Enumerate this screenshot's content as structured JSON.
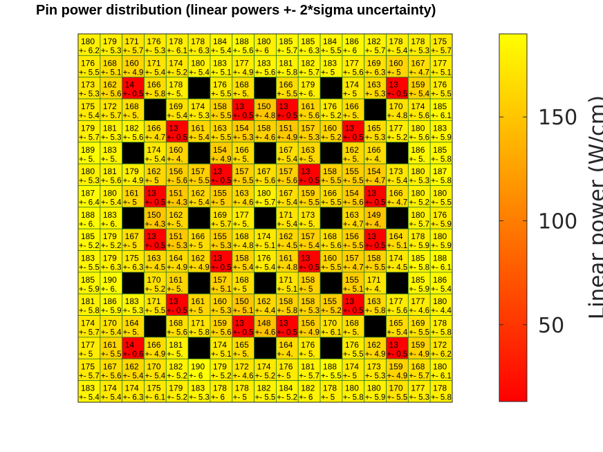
{
  "chart_data": {
    "type": "heatmap",
    "title": "Pin power distribution (linear powers +- 2*sigma uncertainty)",
    "colorbar": {
      "label": "Linear power (W/cm)",
      "ticks": [
        50,
        100,
        150
      ],
      "tick_labels": [
        "50",
        "100",
        "150"
      ],
      "range": [
        13,
        190
      ],
      "colormap": [
        "#ff0000",
        "#ffff00"
      ]
    },
    "values": [
      [
        180,
        179,
        171,
        176,
        178,
        178,
        184,
        188,
        180,
        185,
        185,
        184,
        186,
        182,
        178,
        178,
        175
      ],
      [
        176,
        168,
        160,
        171,
        174,
        180,
        183,
        177,
        183,
        181,
        182,
        183,
        177,
        169,
        160,
        167,
        177
      ],
      [
        173,
        162,
        14,
        166,
        178,
        null,
        176,
        168,
        null,
        166,
        179,
        null,
        174,
        163,
        13,
        159,
        176
      ],
      [
        175,
        172,
        168,
        null,
        169,
        174,
        158,
        13,
        150,
        13,
        161,
        176,
        166,
        null,
        170,
        174,
        185
      ],
      [
        179,
        181,
        182,
        166,
        13,
        161,
        163,
        154,
        158,
        151,
        157,
        160,
        13,
        165,
        177,
        180,
        183
      ],
      [
        189,
        183,
        null,
        174,
        160,
        null,
        154,
        166,
        null,
        167,
        163,
        null,
        162,
        166,
        null,
        186,
        185
      ],
      [
        180,
        181,
        179,
        162,
        156,
        157,
        13,
        157,
        167,
        157,
        13,
        158,
        155,
        154,
        173,
        180,
        187
      ],
      [
        187,
        180,
        161,
        13,
        151,
        162,
        155,
        163,
        180,
        167,
        159,
        166,
        154,
        13,
        166,
        180,
        180
      ],
      [
        188,
        183,
        null,
        150,
        162,
        null,
        169,
        177,
        null,
        171,
        173,
        null,
        163,
        149,
        null,
        180,
        176
      ],
      [
        185,
        179,
        167,
        13,
        151,
        166,
        155,
        168,
        174,
        162,
        157,
        168,
        156,
        13,
        164,
        178,
        180
      ],
      [
        183,
        179,
        175,
        163,
        164,
        162,
        13,
        158,
        176,
        161,
        13,
        160,
        157,
        158,
        174,
        185,
        188
      ],
      [
        185,
        190,
        null,
        170,
        161,
        null,
        157,
        168,
        null,
        171,
        158,
        null,
        155,
        171,
        null,
        185,
        186
      ],
      [
        181,
        186,
        183,
        171,
        13,
        161,
        160,
        150,
        162,
        158,
        158,
        155,
        13,
        163,
        177,
        177,
        180
      ],
      [
        174,
        170,
        164,
        null,
        168,
        171,
        159,
        13,
        148,
        13,
        156,
        170,
        168,
        null,
        165,
        169,
        178
      ],
      [
        177,
        161,
        14,
        166,
        181,
        null,
        174,
        165,
        null,
        164,
        176,
        null,
        176,
        162,
        13,
        159,
        172
      ],
      [
        175,
        167,
        162,
        170,
        182,
        190,
        179,
        172,
        174,
        176,
        181,
        188,
        174,
        173,
        159,
        168,
        180
      ],
      [
        183,
        174,
        174,
        175,
        179,
        183,
        178,
        178,
        182,
        184,
        182,
        178,
        180,
        180,
        170,
        177,
        178
      ]
    ],
    "uncertainty_labels": [
      [
        "+- 6.2",
        "+- 5.3",
        "+- 5.7",
        "+- 5.3",
        "+- 6.1",
        "+- 6.3",
        "+- 5.4",
        "+- 5.6",
        "+- 6",
        "+- 5.7",
        "+- 6.3",
        "+- 5.5",
        "+- 6",
        "+- 5.7",
        "+- 5.4",
        "+- 5.3",
        "+- 5.7"
      ],
      [
        "+- 5.5",
        "+- 5.1",
        "+- 4.9",
        "+- 5.4",
        "+- 5.2",
        "+- 5.4",
        "+- 5.1",
        "+- 4.9",
        "+- 5.6",
        "+- 5.8",
        "+- 5.7",
        "+- 5",
        "+- 5.6",
        "+- 6.3",
        "+- 5",
        "+- 4.7",
        "+- 5.1"
      ],
      [
        "+- 5.3",
        "+- 5.6",
        "+- 0.5",
        "+- 5.8",
        "+- 5.",
        "",
        "+- 5.5",
        "+- 5.",
        "",
        "+- 5.5",
        "+- 6.",
        "",
        "+- 5",
        "+- 5.3",
        "+- 0.5",
        "+- 5.4",
        "+- 5.5"
      ],
      [
        "+- 5.4",
        "+- 5.7",
        "+- 5.",
        "",
        "+- 5.4",
        "+- 5.3",
        "+- 5.5",
        "+- 0.5",
        "+- 4.8",
        "+- 0.5",
        "+- 5.6",
        "+- 5.2",
        "+- 5.",
        "",
        "+- 4.8",
        "+- 5.6",
        "+- 6.1"
      ],
      [
        "+- 5.7",
        "+- 5.3",
        "+- 5.6",
        "+- 4.7",
        "+- 0.5",
        "+- 5.4",
        "+- 5.5",
        "+- 5.3",
        "+- 4.6",
        "+- 4.9",
        "+- 5.3",
        "+- 5.2",
        "+- 0.5",
        "+- 5.3",
        "+- 5.2",
        "+- 5.6",
        "+- 5.9"
      ],
      [
        "+- 5.",
        "+- 5.",
        "",
        "+- 5.4",
        "+- 4.",
        "",
        "+- 4.9",
        "+- 5.",
        "",
        "+- 5.4",
        "+- 5.",
        "",
        "+- 5.",
        "+- 4.",
        "",
        "+- 5.",
        "+- 5.8"
      ],
      [
        "+- 5.3",
        "+- 5.6",
        "+- 4.9",
        "+- 5",
        "+- 5.6",
        "+- 5.5",
        "+- 0.5",
        "+- 5.5",
        "+- 5.6",
        "+- 5.6",
        "+- 0.5",
        "+- 5.5",
        "+- 5.5",
        "+- 4.7",
        "+- 5.4",
        "+- 5.3",
        "+- 5.8"
      ],
      [
        "+- 6.4",
        "+- 5.4",
        "+- 5",
        "+- 0.5",
        "+- 4.3",
        "+- 5.4",
        "+- 5",
        "+- 4.6",
        "+- 5.7",
        "+- 5.4",
        "+- 5.5",
        "+- 5.5",
        "+- 5.6",
        "+- 0.5",
        "+- 4.7",
        "+- 5.2",
        "+- 5.5"
      ],
      [
        "+- 6.",
        "+- 6.",
        "",
        "+- 4.3",
        "+- 5.",
        "",
        "+- 5.7",
        "+- 5.",
        "",
        "+- 5.4",
        "+- 5.",
        "",
        "+- 4.7",
        "+- 4.",
        "",
        "+- 5.7",
        "+- 5.9"
      ],
      [
        "+- 5.2",
        "+- 5.2",
        "+- 5",
        "+- 0.5",
        "+- 5.3",
        "+- 5",
        "+- 5.3",
        "+- 4.8",
        "+- 5.1",
        "+- 4.5",
        "+- 5.4",
        "+- 5.6",
        "+- 5.5",
        "+- 0.5",
        "+- 5.1",
        "+- 5.9",
        "+- 5.9"
      ],
      [
        "+- 5.5",
        "+- 6.3",
        "+- 6.3",
        "+- 4.5",
        "+- 4.9",
        "+- 4.9",
        "+- 0.5",
        "+- 5.4",
        "+- 5.4",
        "+- 4.8",
        "+- 0.5",
        "+- 5.5",
        "+- 4.7",
        "+- 5.5",
        "+- 4.5",
        "+- 5.8",
        "+- 6.1"
      ],
      [
        "+- 5.9",
        "+- 6.",
        "",
        "+- 5.2",
        "+- 5.",
        "",
        "+- 5.1",
        "+- 5",
        "",
        "+- 5.1",
        "+- 5",
        "",
        "+- 5.1",
        "+- 4.",
        "",
        "+- 5.9",
        "+- 5.4"
      ],
      [
        "+- 5.8",
        "+- 5.9",
        "+- 5.3",
        "+- 5.5",
        "+- 0.5",
        "+- 5",
        "+- 5.3",
        "+- 5.1",
        "+- 4.4",
        "+- 5.8",
        "+- 5.3",
        "+- 5.2",
        "+- 0.5",
        "+- 5.8",
        "+- 5.6",
        "+- 4.6",
        "+- 4.4"
      ],
      [
        "+- 5.7",
        "+- 5.4",
        "+- 5.",
        "",
        "+- 5.6",
        "+- 5.8",
        "+- 5.6",
        "+- 0.5",
        "+- 4.6",
        "+- 0.5",
        "+- 4.9",
        "+- 6.1",
        "+- 5.",
        "",
        "+- 5.4",
        "+- 5.5",
        "+- 5.8"
      ],
      [
        "+- 5",
        "+- 5.5",
        "+- 0.6",
        "+- 4.9",
        "+- 5.",
        "",
        "+- 5.1",
        "+- 5.",
        "",
        "+- 4.",
        "+- 5.",
        "",
        "+- 5.5",
        "+- 4.9",
        "+- 0.5",
        "+- 4.9",
        "+- 6.2"
      ],
      [
        "+- 5.7",
        "+- 5.6",
        "+- 5.4",
        "+- 5.4",
        "+- 5.2",
        "+- 6",
        "+- 5.2",
        "+- 4.6",
        "+- 5.2",
        "+- 5",
        "+- 5.7",
        "+- 5.5",
        "+- 5",
        "+- 5.3",
        "+- 4.9",
        "+- 5.7",
        "+- 6.1"
      ],
      [
        "+- 5.4",
        "+- 5.4",
        "+- 6.3",
        "+- 6.1",
        "+- 5.2",
        "+- 5.3",
        "+- 6",
        "+- 5",
        "+- 5.5",
        "+- 5.2",
        "+- 6",
        "+- 5",
        "+- 5.8",
        "+- 5.9",
        "+- 5.5",
        "+- 5.3",
        "+- 5.8"
      ]
    ],
    "empty_cell_color": "#000000",
    "grid_line_color": "#2a7a2a"
  }
}
